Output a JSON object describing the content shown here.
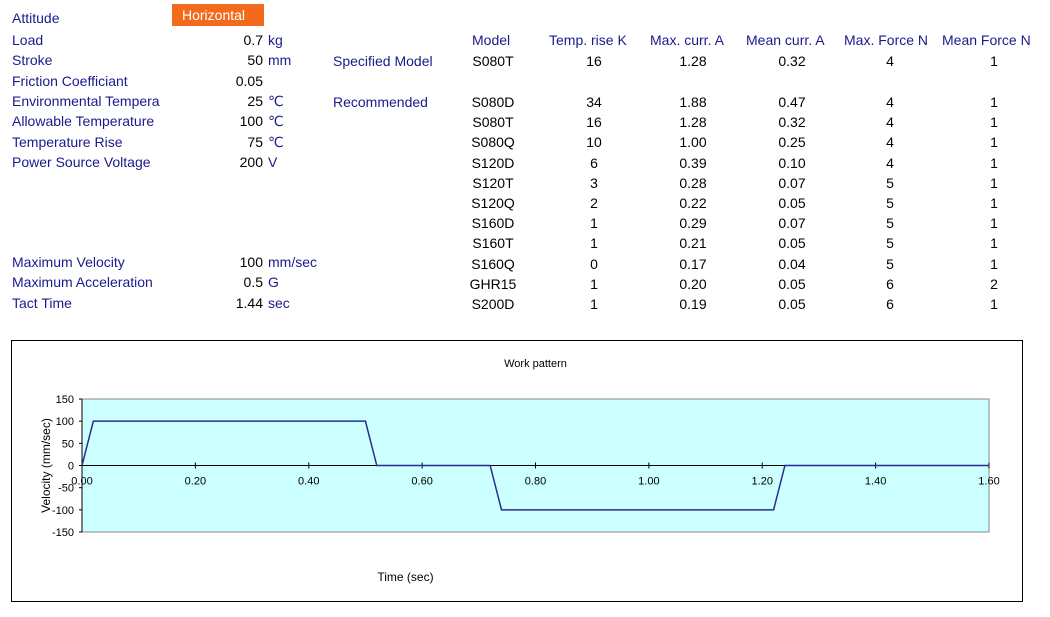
{
  "form": {
    "attitude": {
      "label": "Attitude",
      "value": "Horizontal"
    },
    "params": [
      {
        "label": "Load",
        "value": "0.7",
        "unit": "kg"
      },
      {
        "label": "Stroke",
        "value": "50",
        "unit": "mm"
      },
      {
        "label": "Friction Coefficiant",
        "value": "0.05",
        "unit": ""
      },
      {
        "label": "Environmental Tempera",
        "value": "25",
        "unit": "℃"
      },
      {
        "label": "Allowable Temperature",
        "value": "100",
        "unit": "℃"
      },
      {
        "label": "Temperature Rise",
        "value": "75",
        "unit": "℃"
      },
      {
        "label": "Power Source Voltage",
        "value": "200",
        "unit": "V"
      }
    ],
    "motion": [
      {
        "label": "Maximum Velocity",
        "value": "100",
        "unit": "mm/sec"
      },
      {
        "label": "Maximum Acceleration",
        "value": "0.5",
        "unit": "G"
      },
      {
        "label": "Tact Time",
        "value": "1.44",
        "unit": "sec"
      }
    ]
  },
  "table": {
    "specified_label": "Specified Model",
    "recommended_label": "Recommended",
    "headers": [
      "Model",
      "Temp. rise K",
      "Max. curr. A",
      "Mean curr. A",
      "Max. Force N",
      "Mean Force N"
    ],
    "specified_row": [
      "S080T",
      "16",
      "1.28",
      "0.32",
      "4",
      "1"
    ],
    "rows": [
      [
        "S080D",
        "34",
        "1.88",
        "0.47",
        "4",
        "1"
      ],
      [
        "S080T",
        "16",
        "1.28",
        "0.32",
        "4",
        "1"
      ],
      [
        "S080Q",
        "10",
        "1.00",
        "0.25",
        "4",
        "1"
      ],
      [
        "S120D",
        "6",
        "0.39",
        "0.10",
        "4",
        "1"
      ],
      [
        "S120T",
        "3",
        "0.28",
        "0.07",
        "5",
        "1"
      ],
      [
        "S120Q",
        "2",
        "0.22",
        "0.05",
        "5",
        "1"
      ],
      [
        "S160D",
        "1",
        "0.29",
        "0.07",
        "5",
        "1"
      ],
      [
        "S160T",
        "1",
        "0.21",
        "0.05",
        "5",
        "1"
      ],
      [
        "S160Q",
        "0",
        "0.17",
        "0.04",
        "5",
        "1"
      ],
      [
        "GHR15",
        "1",
        "0.20",
        "0.05",
        "6",
        "2"
      ],
      [
        "S200D",
        "1",
        "0.19",
        "0.05",
        "6",
        "1"
      ]
    ]
  },
  "colors": {
    "accent": "#f26a1b",
    "label": "#1a1a8c",
    "plot_bg": "#ccffff",
    "line": "#2b2b8f"
  },
  "chart_data": {
    "type": "line",
    "title": "Work pattern",
    "xlabel": "Time (sec)",
    "ylabel": "Velocity (mm/sec)",
    "xlim": [
      0,
      1.6
    ],
    "ylim": [
      -150,
      150
    ],
    "xticks": [
      "0.00",
      "0.20",
      "0.40",
      "0.60",
      "0.80",
      "1.00",
      "1.20",
      "1.40",
      "1.60"
    ],
    "xtick_values": [
      0,
      0.2,
      0.4,
      0.6,
      0.8,
      1.0,
      1.2,
      1.4,
      1.6
    ],
    "yticks": [
      "150",
      "100",
      "50",
      "0",
      "-50",
      "-100",
      "-150"
    ],
    "ytick_values": [
      150,
      100,
      50,
      0,
      -50,
      -100,
      -150
    ],
    "grid": false,
    "series": [
      {
        "x": [
          0,
          0.02,
          0.5,
          0.52,
          0.72,
          0.74,
          1.22,
          1.24,
          1.6
        ],
        "y": [
          0,
          100,
          100,
          0,
          0,
          -100,
          -100,
          0,
          0
        ]
      }
    ]
  }
}
